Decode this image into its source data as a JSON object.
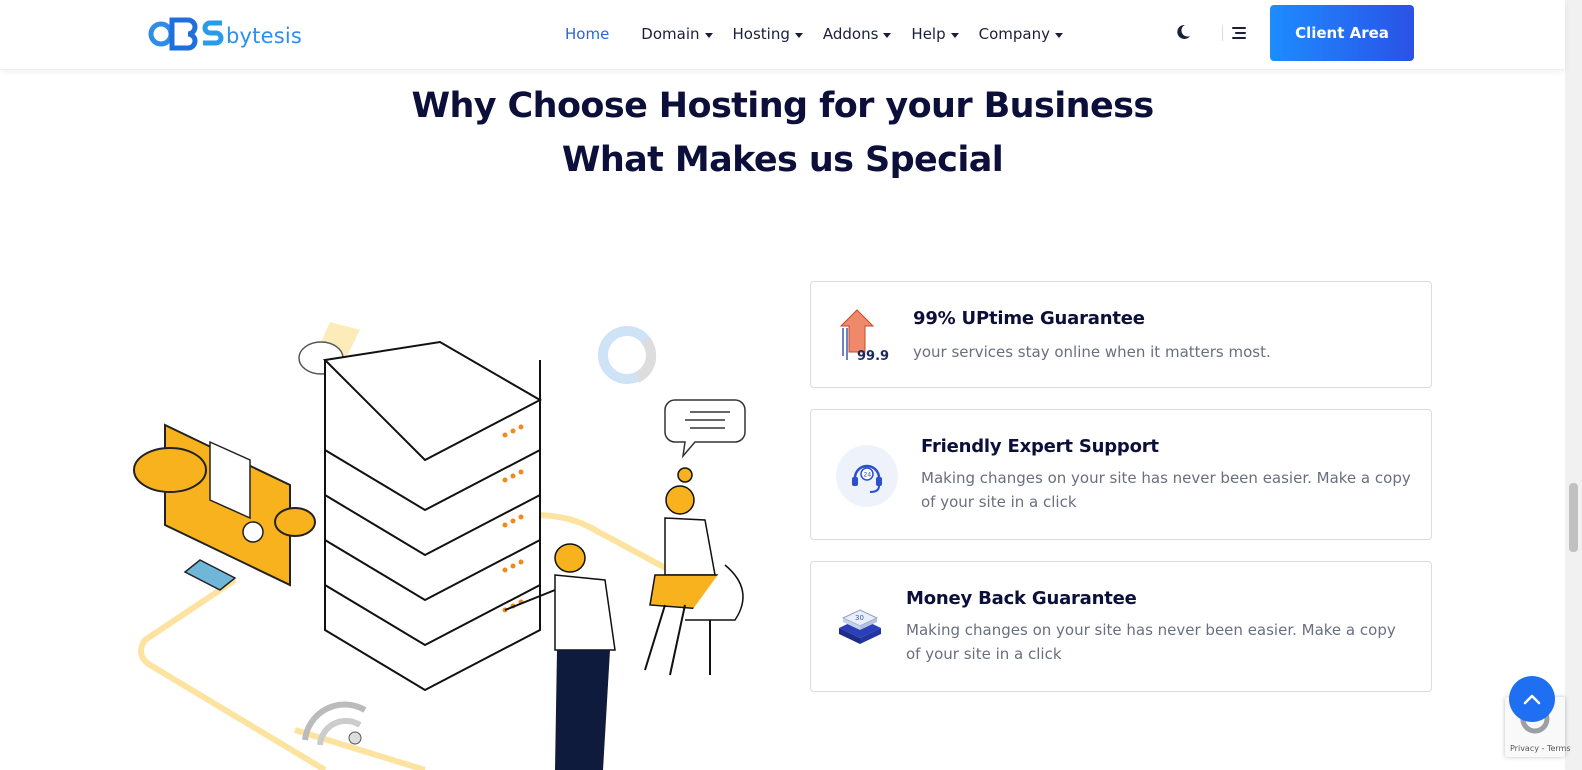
{
  "brand": {
    "logo_text": "bytesis",
    "logo_letters": "BS"
  },
  "nav": {
    "items": [
      {
        "label": "Home",
        "active": true,
        "dropdown": false
      },
      {
        "label": "Domain",
        "dropdown": true
      },
      {
        "label": "Hosting",
        "dropdown": true
      },
      {
        "label": "Addons",
        "dropdown": true
      },
      {
        "label": "Help",
        "dropdown": true
      },
      {
        "label": "Company",
        "dropdown": true
      }
    ],
    "theme_icon": "moon-icon",
    "menu_icon": "hamburger-icon",
    "client_area_label": "Client Area"
  },
  "section": {
    "title_line1": "Why Choose Hosting for your Business",
    "title_line2": "What Makes us Special"
  },
  "features": [
    {
      "icon": "uptime-arrow-icon",
      "icon_text": "99.9",
      "title": "99% UPtime Guarantee",
      "description": "your services stay online when it matters most."
    },
    {
      "icon": "support-headset-icon",
      "icon_text": "24",
      "title": "Friendly Expert Support",
      "description": "Making changes on your site has never been easier. Make a copy of your site in a click"
    },
    {
      "icon": "money-back-box-icon",
      "icon_text": "30",
      "title": "Money Back Guarantee",
      "description": "Making changes on your site has never been easier. Make a copy of your site in a click"
    }
  ],
  "recaptcha": {
    "text": "Privacy - Terms"
  },
  "colors": {
    "accent": "#1e6ff2",
    "heading": "#0b0f3a",
    "illustration_orange": "#f7b21d",
    "nav_active": "#2f63d8"
  }
}
